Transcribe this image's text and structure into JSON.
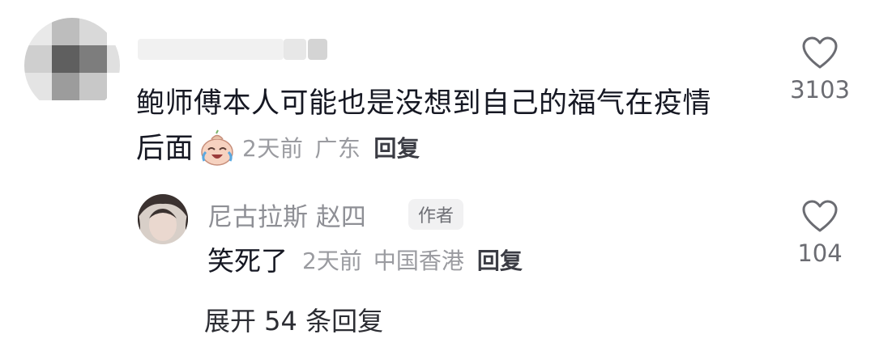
{
  "comment": {
    "text": "鲍师傅本人可能也是没想到自己的福气在疫情后面",
    "text_line1": "鲍师傅本人可能也是没想到自己的福气在疫情",
    "text_line2": "后面",
    "emoji": "crying-laughing-sticker-icon",
    "time": "2天前",
    "location": "广东",
    "reply_label": "回复",
    "likes": "3103"
  },
  "reply": {
    "username": "尼古拉斯 赵四",
    "badge": "作者",
    "text": "笑死了",
    "time": "2天前",
    "location": "中国香港",
    "reply_label": "回复",
    "likes": "104"
  },
  "expand_label": "展开 54 条回复",
  "colors": {
    "text": "#161823",
    "meta": "#9a9ba0",
    "badge_bg": "#f1f1f2"
  }
}
